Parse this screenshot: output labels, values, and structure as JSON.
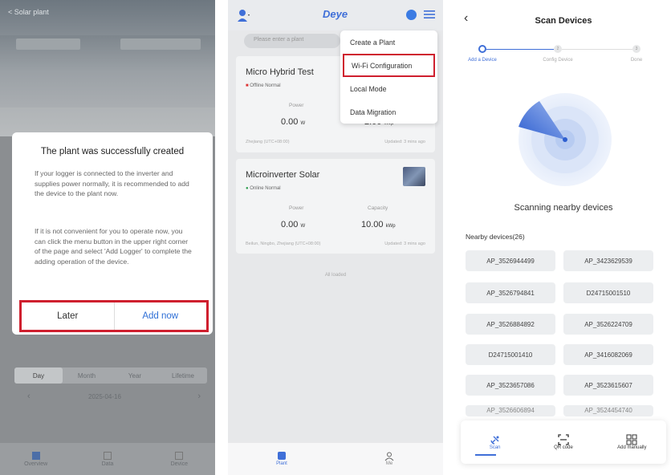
{
  "panel1": {
    "topbar_left": "< Solar plant",
    "topbar_right": "",
    "dialog": {
      "title": "The plant was successfully created",
      "para1": "If your logger is connected to the inverter and supplies power normally, it is recommended to add the device to the plant now.",
      "para2": "If it is not convenient for you to operate now, you can click the menu button in the upper right corner of the page and select 'Add Logger' to complete the adding operation of the device.",
      "later": "Later",
      "add_now": "Add now"
    },
    "periods": [
      "Day",
      "Month",
      "Year",
      "Lifetime"
    ],
    "date": "2025-04-16",
    "nav": [
      "Overview",
      "Data",
      "Device"
    ]
  },
  "panel2": {
    "logo": "Deye",
    "search_placeholder": "Please enter a plant",
    "menu": [
      "Create a Plant",
      "Wi-Fi Configuration",
      "Local Mode",
      "Data Migration"
    ],
    "cards": [
      {
        "name": "Micro Hybrid Test",
        "status": "Offline  Normal",
        "power_label": "Power",
        "power_value": "0.00",
        "power_unit": "W",
        "capacity_label": "Capacity",
        "capacity_value": "2.00",
        "capacity_unit": "kWp",
        "location": "Zhejiang (UTC+08:00)",
        "updated": "Updated: 3 mins ago"
      },
      {
        "name": "Microinverter Solar",
        "status": "Online  Normal",
        "power_label": "Power",
        "power_value": "0.00",
        "power_unit": "W",
        "capacity_label": "Capacity",
        "capacity_value": "10.00",
        "capacity_unit": "kWp",
        "location": "Beilun, Ningbo, Zhejiang (UTC+08:00)",
        "updated": "Updated: 3 mins ago"
      }
    ],
    "all_loaded": "All loaded",
    "nav": [
      "Plant",
      "Me"
    ]
  },
  "panel3": {
    "title": "Scan Devices",
    "steps": [
      "Add a Device",
      "Config Device",
      "Done"
    ],
    "step_numbers": [
      "",
      "2",
      "3"
    ],
    "scanning": "Scanning nearby devices",
    "nearby_label": "Nearby devices(26)",
    "devices": [
      "AP_3526944499",
      "AP_3423629539",
      "AP_3526794841",
      "D24715001510",
      "AP_3526884892",
      "AP_3526224709",
      "D24715001410",
      "AP_3416082069",
      "AP_3523657086",
      "AP_3523615607",
      "AP_3526606894",
      "AP_3524454740"
    ],
    "bottom": [
      "Scan",
      "QR code",
      "Add manually"
    ]
  },
  "colors": {
    "accent": "#3f6fd8",
    "highlight": "#cf1f2e"
  }
}
